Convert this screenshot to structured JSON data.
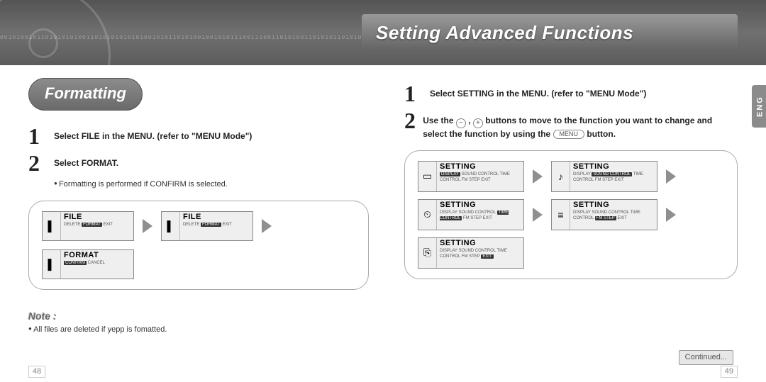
{
  "banner": {
    "bits": "00101001011010101010011010101010101001010110101001001010111001110011010100110101011010101001011011101001100101101",
    "title": "Setting Advanced Functions"
  },
  "left": {
    "heading": "Formatting",
    "step1": "Select FILE in the MENU. (refer to \"MENU Mode\")",
    "step2": "Select FORMAT.",
    "step2_note": "Formatting is performed if CONFIRM is selected.",
    "lcd1": {
      "title": "FILE",
      "opts": [
        "DELETE",
        "FORMAT",
        "EXIT"
      ],
      "sel": 1
    },
    "lcd2": {
      "title": "FILE",
      "opts": [
        "DELETE",
        "FORMAT",
        "EXIT"
      ],
      "sel": 1
    },
    "lcd3": {
      "title": "FORMAT",
      "opts": [
        "CONFIRM",
        "CANCEL"
      ],
      "sel": 0
    },
    "note_label": "Note :",
    "note_body": "All files are deleted if yepp is fomatted."
  },
  "right": {
    "step1": "Select SETTING in the MENU. (refer to \"MENU Mode\")",
    "step2a": "Use the ",
    "step2b": " buttons to move to the function you want to change and select the function by using the ",
    "step2c": " button.",
    "menu_btn": "MENU",
    "screens": [
      {
        "title": "SETTING",
        "icon": "▭",
        "opts": [
          "DISPLAY",
          "SOUND CONTROL",
          "TIME CONTROL",
          "FM STEP",
          "EXIT"
        ],
        "sel": 0
      },
      {
        "title": "SETTING",
        "icon": "♪",
        "opts": [
          "DISPLAY",
          "SOUND CONTROL",
          "TIME CONTROL",
          "FM STEP",
          "EXIT"
        ],
        "sel": 1
      },
      {
        "title": "SETTING",
        "icon": "⏲",
        "opts": [
          "DISPLAY",
          "SOUND CONTROL",
          "TIME CONTROL",
          "FM STEP",
          "EXIT"
        ],
        "sel": 2
      },
      {
        "title": "SETTING",
        "icon": "≡",
        "opts": [
          "DISPLAY",
          "SOUND CONTROL",
          "TIME CONTROL",
          "FM STEP",
          "EXIT"
        ],
        "sel": 3
      },
      {
        "title": "SETTING",
        "icon": "⎘",
        "opts": [
          "DISPLAY",
          "SOUND CONTROL",
          "TIME CONTROL",
          "FM STEP",
          "EXIT"
        ],
        "sel": 4
      }
    ],
    "continued": "Continued..."
  },
  "lang_tab": "ENG",
  "page_left": "48",
  "page_right": "49"
}
